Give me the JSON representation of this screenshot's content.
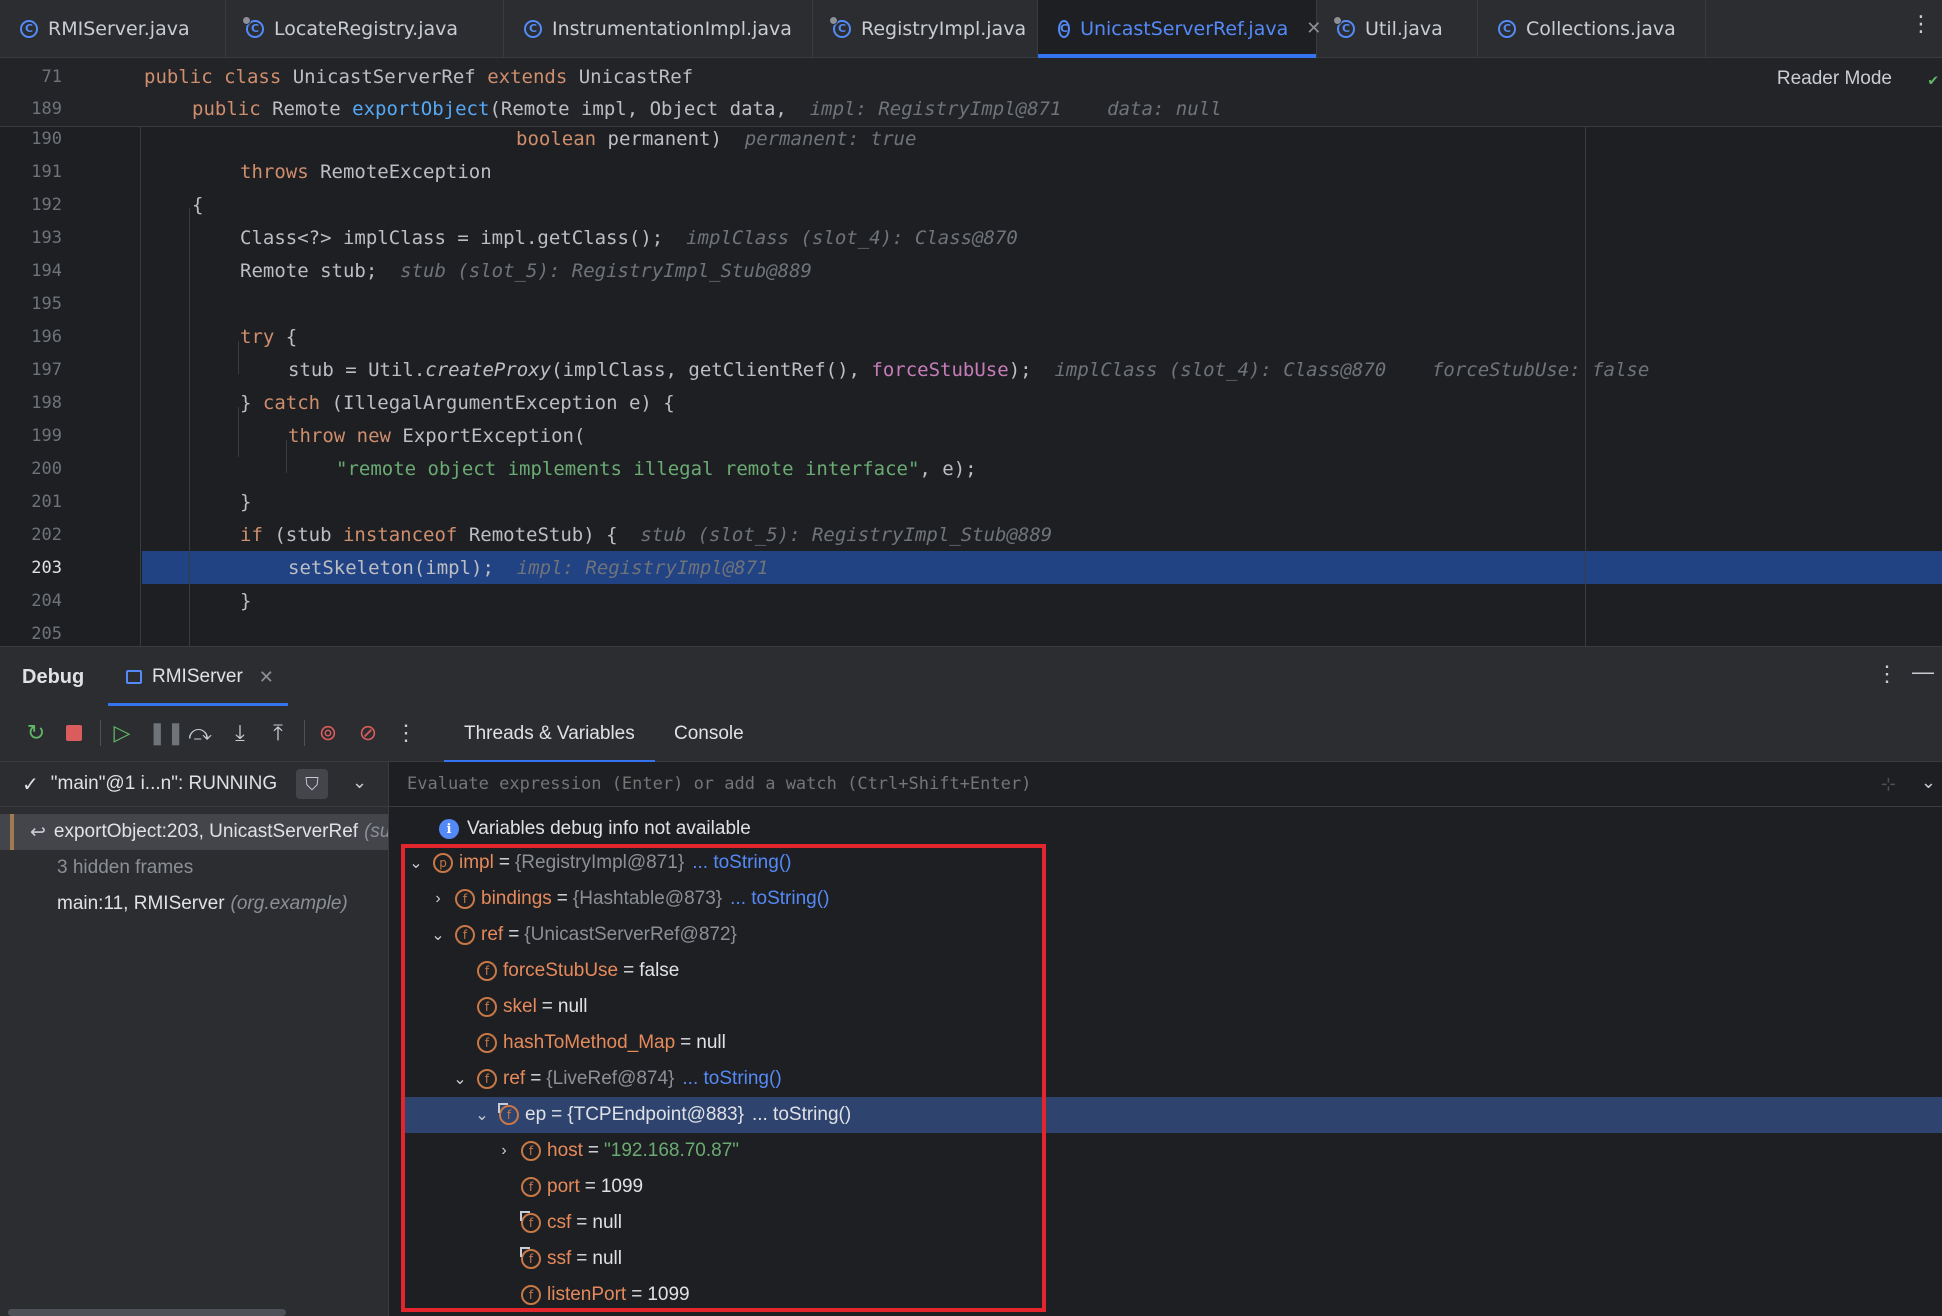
{
  "tabs": [
    {
      "label": "RMIServer.java",
      "pinned": false,
      "active": false
    },
    {
      "label": "LocateRegistry.java",
      "pinned": true,
      "active": false
    },
    {
      "label": "InstrumentationImpl.java",
      "pinned": false,
      "active": false
    },
    {
      "label": "RegistryImpl.java",
      "pinned": true,
      "active": false
    },
    {
      "label": "UnicastServerRef.java",
      "pinned": false,
      "active": true
    },
    {
      "label": "Util.java",
      "pinned": true,
      "active": false
    },
    {
      "label": "Collections.java",
      "pinned": false,
      "active": false
    }
  ],
  "editor": {
    "reader_mode": "Reader Mode",
    "sticky": [
      {
        "num": "71",
        "code": "public class UnicastServerRef extends UnicastRef"
      },
      {
        "num": "189",
        "code": "public Remote exportObject(Remote impl, Object data,",
        "hint1": "impl: RegistryImpl@871",
        "hint2": "data: null"
      }
    ],
    "lines": [
      {
        "num": "190",
        "code": "boolean permanent)",
        "hint": "permanent: true"
      },
      {
        "num": "191",
        "code": "throws RemoteException"
      },
      {
        "num": "192",
        "code": "{"
      },
      {
        "num": "193",
        "code": "Class<?> implClass = impl.getClass();",
        "hint": "implClass (slot_4): Class@870"
      },
      {
        "num": "194",
        "code": "Remote stub;",
        "hint": "stub (slot_5): RegistryImpl_Stub@889"
      },
      {
        "num": "195",
        "code": ""
      },
      {
        "num": "196",
        "code": "try {"
      },
      {
        "num": "197",
        "code": "stub = Util.createProxy(implClass, getClientRef(), forceStubUse);",
        "hint": "implClass (slot_4): Class@870",
        "hint2": "forceStubUse: false"
      },
      {
        "num": "198",
        "code": "} catch (IllegalArgumentException e) {"
      },
      {
        "num": "199",
        "code": "throw new ExportException("
      },
      {
        "num": "200",
        "code": "\"remote object implements illegal remote interface\", e);"
      },
      {
        "num": "201",
        "code": "}"
      },
      {
        "num": "202",
        "code": "if (stub instanceof RemoteStub) {",
        "hint": "stub (slot_5): RegistryImpl_Stub@889"
      },
      {
        "num": "203",
        "code": "setSkeleton(impl);",
        "hint": "impl: RegistryImpl@871"
      },
      {
        "num": "204",
        "code": "}"
      },
      {
        "num": "205",
        "code": ""
      }
    ]
  },
  "debug": {
    "title": "Debug",
    "session_tab": "RMIServer",
    "subtabs": [
      "Threads & Variables",
      "Console"
    ],
    "thread": "\"main\"@1 i...n\": RUNNING",
    "frames": [
      {
        "method": "exportObject:203, UnicastServerRef",
        "pkg": "(sun.rmi.server)"
      },
      {
        "method": "3 hidden frames",
        "pkg": ""
      },
      {
        "method": "main:11, RMIServer",
        "pkg": "(org.example)"
      }
    ],
    "eval_placeholder": "Evaluate expression (Enter) or add a watch (Ctrl+Shift+Enter)",
    "info": "Variables debug info not available",
    "variables": [
      {
        "arrow": "down",
        "badge": "p",
        "name": "impl",
        "type": "{RegistryImpl@871}",
        "link": "... toString()"
      },
      {
        "arrow": "right",
        "badge": "f",
        "name": "bindings",
        "type": "{Hashtable@873}",
        "link": "... toString()"
      },
      {
        "arrow": "down",
        "badge": "f",
        "name": "ref",
        "type": "{UnicastServerRef@872}"
      },
      {
        "arrow": "",
        "badge": "f",
        "name": "forceStubUse",
        "value": "false"
      },
      {
        "arrow": "",
        "badge": "f",
        "name": "skel",
        "value": "null"
      },
      {
        "arrow": "",
        "badge": "f",
        "name": "hashToMethod_Map",
        "value": "null"
      },
      {
        "arrow": "down",
        "badge": "f",
        "name": "ref",
        "type": "{LiveRef@874}",
        "link": "... toString()"
      },
      {
        "arrow": "down",
        "badge": "f",
        "name": "ep",
        "type": "{TCPEndpoint@883}",
        "link": "... toString()"
      },
      {
        "arrow": "right",
        "badge": "f",
        "name": "host",
        "str": "\"192.168.70.87\""
      },
      {
        "arrow": "",
        "badge": "f",
        "name": "port",
        "value": "1099"
      },
      {
        "arrow": "",
        "badge": "f",
        "name": "csf",
        "value": "null"
      },
      {
        "arrow": "",
        "badge": "f",
        "name": "ssf",
        "value": "null"
      },
      {
        "arrow": "",
        "badge": "f",
        "name": "listenPort",
        "value": "1099"
      }
    ]
  }
}
